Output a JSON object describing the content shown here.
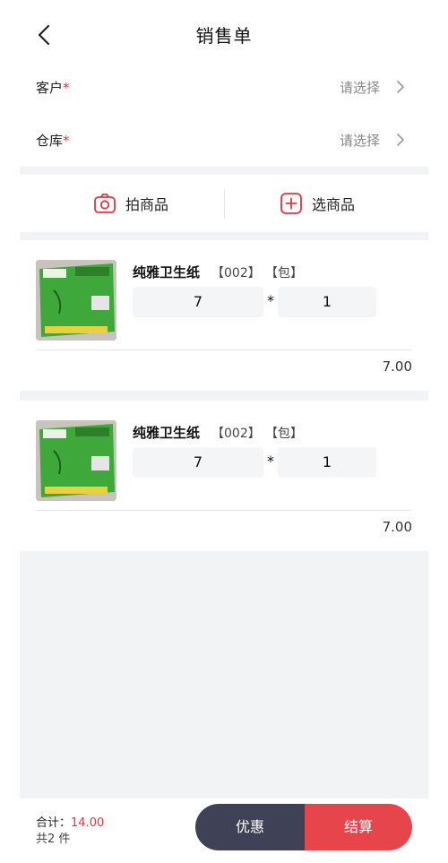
{
  "header": {
    "title": "销售单"
  },
  "form": {
    "customer": {
      "label": "客户",
      "required": "*",
      "value": "请选择"
    },
    "warehouse": {
      "label": "仓库",
      "required": "*",
      "value": "请选择"
    }
  },
  "actions": {
    "photo_label": "拍商品",
    "select_label": "选商品"
  },
  "items": [
    {
      "name": "纯雅卫生纸",
      "code": "【002】",
      "unit": "【包】",
      "price": "7",
      "times": "*",
      "qty": "1",
      "subtotal": "7.00"
    },
    {
      "name": "纯雅卫生纸",
      "code": "【002】",
      "unit": "【包】",
      "price": "7",
      "times": "*",
      "qty": "1",
      "subtotal": "7.00"
    }
  ],
  "footer": {
    "total_label": "合计：",
    "total_amount": "14.00",
    "count_text": "共2 件",
    "discount_label": "优惠",
    "checkout_label": "结算"
  },
  "colors": {
    "accent": "#e3343f",
    "dark_button": "#3f4256",
    "checkout_button": "#e7454c",
    "band": "#f2f3f5"
  }
}
